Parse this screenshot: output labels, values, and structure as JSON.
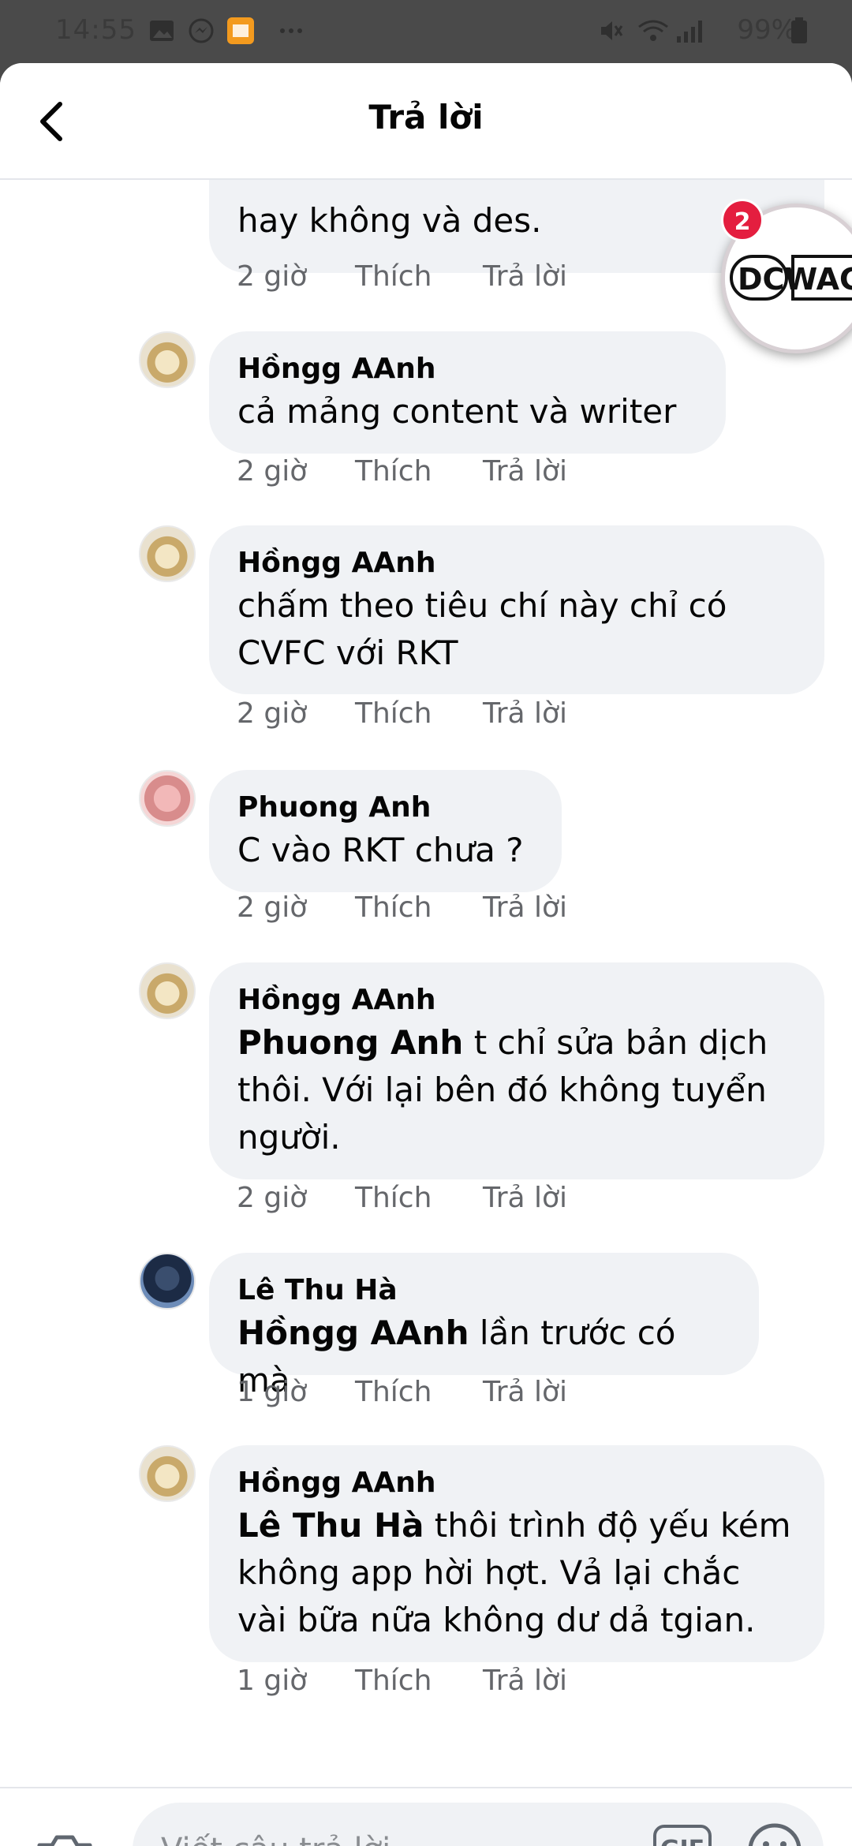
{
  "status_bar": {
    "time": "14:55",
    "battery": "99%",
    "icons": [
      "image-icon",
      "messenger-icon",
      "baomoi-icon",
      "more-icon",
      "mute-icon",
      "wifi-icon",
      "signal-icon",
      "battery-icon"
    ]
  },
  "header": {
    "title": "Trả lời"
  },
  "chathead": {
    "badge": "2",
    "logo_text": "DCWAC"
  },
  "comments": [
    {
      "author": "",
      "text": "hay không và des.",
      "time": "2 giờ",
      "like": "Thích",
      "reply": "Trả lời"
    },
    {
      "author": "Hồngg AAnh",
      "text": "cả mảng content và writer",
      "time": "2 giờ",
      "like": "Thích",
      "reply": "Trả lời"
    },
    {
      "author": "Hồngg AAnh",
      "text": "chấm theo tiêu chí này chỉ có CVFC với RKT",
      "time": "2 giờ",
      "like": "Thích",
      "reply": "Trả lời"
    },
    {
      "author": "Phuong Anh",
      "text": "C vào RKT chưa ?",
      "time": "2 giờ",
      "like": "Thích",
      "reply": "Trả lời"
    },
    {
      "author": "Hồngg AAnh",
      "mention": "Phuong Anh",
      "text": " t chỉ sửa bản dịch thôi. Với lại bên đó không tuyển người.",
      "time": "2 giờ",
      "like": "Thích",
      "reply": "Trả lời"
    },
    {
      "author": "Lê Thu Hà",
      "mention": "Hồngg AAnh",
      "text": " lần trước có mà",
      "time": "1 giờ",
      "like": "Thích",
      "reply": "Trả lời"
    },
    {
      "author": "Hồngg AAnh",
      "mention": "Lê Thu Hà",
      "text": " thôi trình độ yếu kém không app hời hợt. Vả lại chắc vài bữa nữa không dư dả tgian.",
      "time": "1 giờ",
      "like": "Thích",
      "reply": "Trả lời"
    }
  ],
  "composer": {
    "placeholder": "Viết câu trả lời...",
    "gif_label": "GIF"
  },
  "colors": {
    "bubble": "#f0f2f5",
    "meta": "#65676b",
    "badge": "#e41e3f"
  }
}
